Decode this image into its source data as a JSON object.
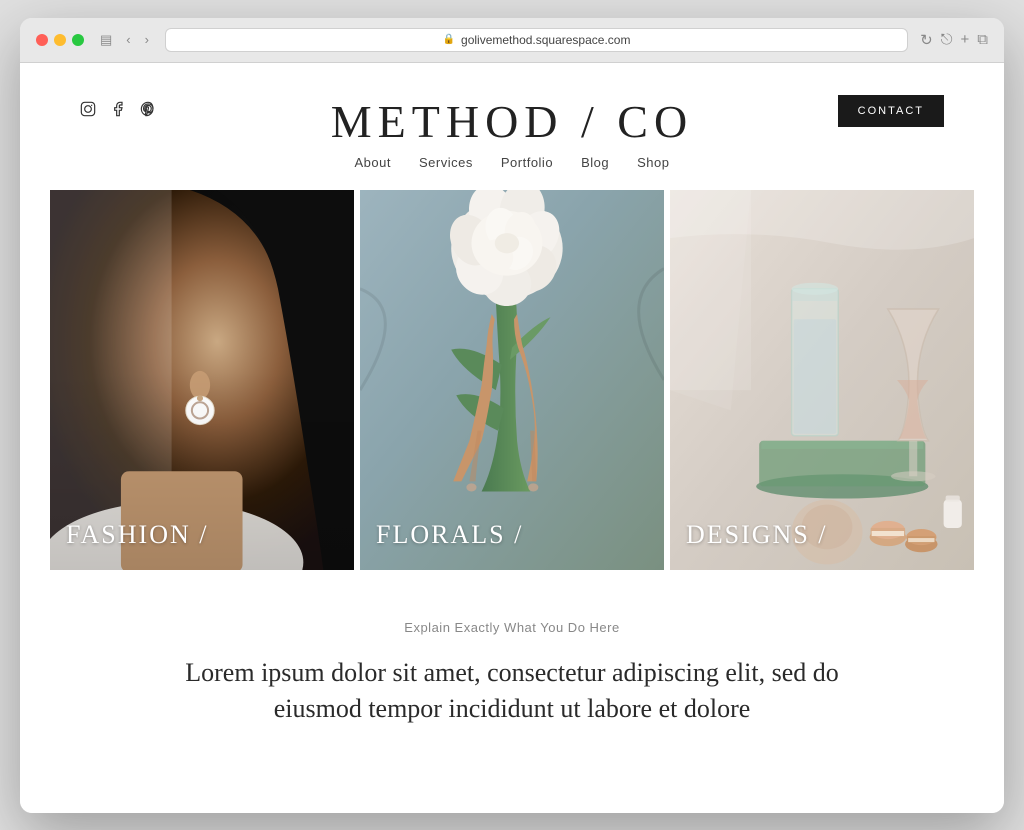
{
  "browser": {
    "url": "golivemethod.squarespace.com",
    "back_label": "‹",
    "forward_label": "›"
  },
  "header": {
    "title": "METHOD / CO",
    "contact_label": "CONTACT"
  },
  "social": {
    "instagram": "IG",
    "facebook": "f",
    "pinterest": "P"
  },
  "nav": {
    "items": [
      {
        "label": "About"
      },
      {
        "label": "Services"
      },
      {
        "label": "Portfolio"
      },
      {
        "label": "Blog"
      },
      {
        "label": "Shop"
      }
    ]
  },
  "hero": {
    "cards": [
      {
        "label": "FASHION /",
        "id": "fashion"
      },
      {
        "label": "FLORALS /",
        "id": "florals"
      },
      {
        "label": "DESIGNS /",
        "id": "designs"
      }
    ]
  },
  "content": {
    "subtitle": "Explain Exactly What You Do Here",
    "body": "Lorem ipsum dolor sit amet, consectetur adipiscing elit, sed do eiusmod tempor incididunt ut labore et dolore"
  },
  "icons": {
    "lock": "🔒",
    "share": "⎋",
    "add_tab": "+",
    "window": "⧉",
    "refresh": "↻",
    "sidebar": "▤",
    "chevron_left": "‹",
    "chevron_right": "›"
  }
}
